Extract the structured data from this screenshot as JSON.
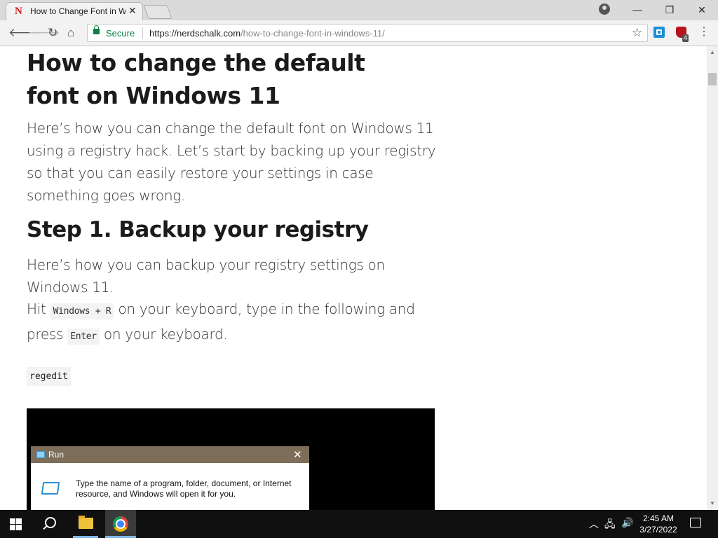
{
  "browser": {
    "tab_title": "How to Change Font in W",
    "tab_favicon": "N",
    "window_controls": {
      "minimize": "—",
      "restore": "❐",
      "close": "✕"
    },
    "security_label": "Secure",
    "url_base": "https://nerdschalk.com",
    "url_path": "/how-to-change-font-in-windows-11/",
    "extension_badge": "4"
  },
  "article": {
    "heading": "How to change the default font on Windows 11",
    "intro": "Here’s how you can change the default font on Windows 11 using a registry hack. Let’s start by backing up your registry so that you can easily restore your settings in case something goes wrong.",
    "step_heading": "Step 1. Backup your registry",
    "step_intro": "Here’s how you can backup your registry settings on Windows 11.",
    "step_p1_a": "Hit ",
    "step_p1_key1": "Windows + R",
    "step_p1_b": " on your keyboard, type in the following and press ",
    "step_p1_key2": "Enter",
    "step_p1_c": " on your keyboard.",
    "code_block": "regedit",
    "run_dialog": {
      "title": "Run",
      "text": "Type the name of a program, folder, document, or Internet resource, and Windows will open it for you."
    }
  },
  "taskbar": {
    "time": "2:45 AM",
    "date": "3/27/2022"
  },
  "colors": {
    "secure_green": "#0b8043",
    "taskbar_bg": "#101010",
    "run_titlebar": "#7d6e5a"
  }
}
